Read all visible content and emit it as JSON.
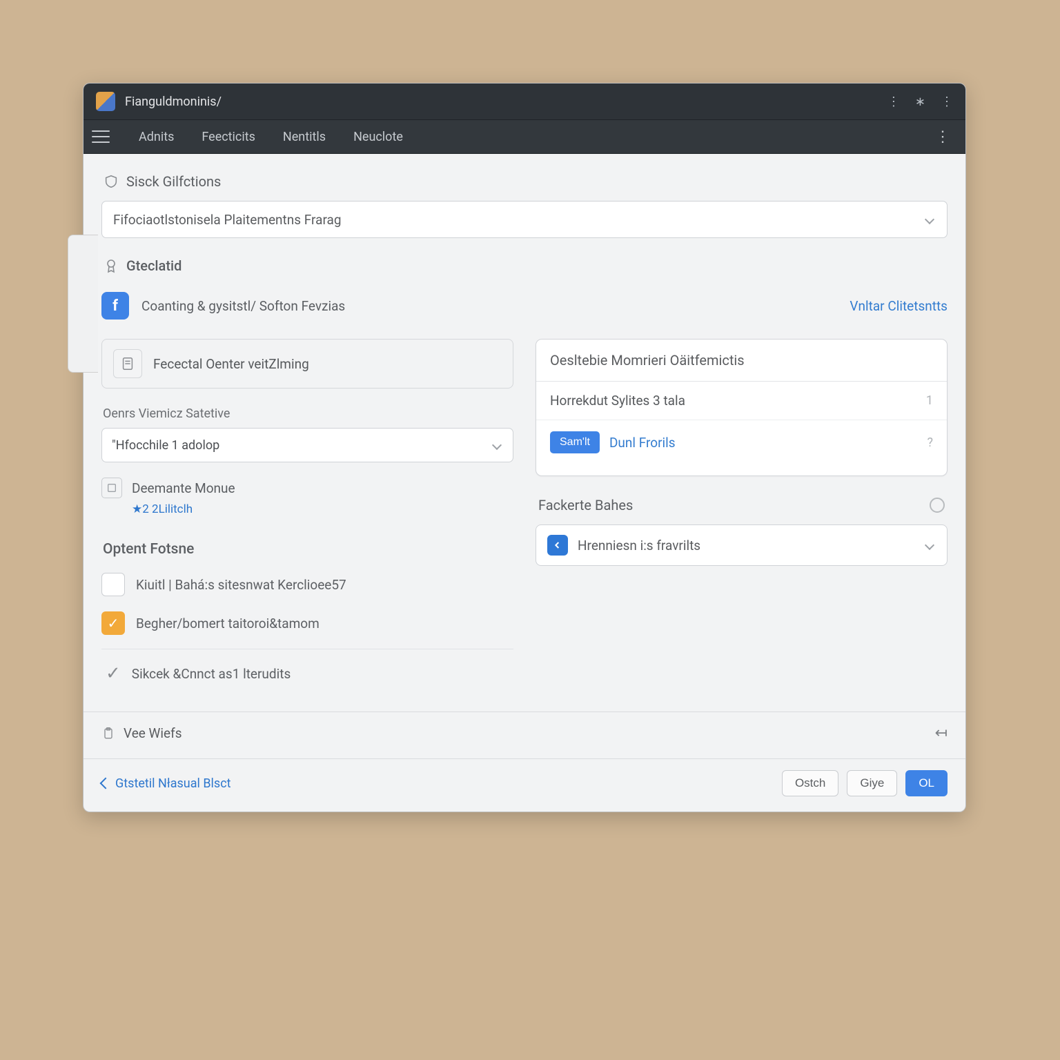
{
  "window": {
    "title": "Fianguldmoninis/"
  },
  "menu": {
    "items": [
      "Adnits",
      "Feecticits",
      "Nentitls",
      "Neuclote"
    ]
  },
  "section1": {
    "header": "Sisck Gilfctions",
    "select_value": "Fifociaotlstonisela Plaitementns Frarag"
  },
  "section2": {
    "header": "Gteclatid"
  },
  "coaching": {
    "text": "Coanting & gysitstl/ Softon Fevzias",
    "link": "Vnltar Clitetsntts"
  },
  "received": {
    "text": "Fecectal Oenter veitZlming"
  },
  "owners": {
    "label": "Oenrs Viemicz Satetive",
    "select_value": "\"Hfocchile 1 adolop"
  },
  "demante": {
    "label": "Deemante Monue",
    "count": "★2 2Lilitclh"
  },
  "options": {
    "header": "Optent Fotsne",
    "opt1": "Kiuitl | Bahá:s sitesnwat Kerclioee57",
    "opt2": "Begher/bomert taitoroi&tamom",
    "opt3": "Sikcek &Cnnct as1 lterudits"
  },
  "right_card": {
    "title": "Oesltebie Momrieri Oäitfemictis",
    "row1": "Horrekdut Sylites 3 tala",
    "row1_count": "1",
    "send_btn": "Sam'lt",
    "link": "Dunl Frorils"
  },
  "right_section": {
    "label": "Fackerte Bahes",
    "select_value": "Hrenniesn i:s fravrilts"
  },
  "view": {
    "label": "Vee Wiefs"
  },
  "footer": {
    "back": "Gtstetil Nłasual Blsct",
    "btn1": "Ostch",
    "btn2": "Giye",
    "btn3": "OL"
  }
}
